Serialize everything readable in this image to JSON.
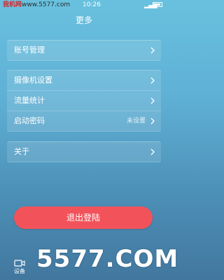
{
  "status_bar": {
    "site_name": "我机网",
    "site_url": "www.5577.com",
    "time": "10:26"
  },
  "header": {
    "title": "更多"
  },
  "sections": [
    {
      "items": [
        {
          "label": "账号管理"
        }
      ]
    },
    {
      "items": [
        {
          "label": "摄像机设置"
        },
        {
          "label": "流量统计"
        },
        {
          "label": "启动密码",
          "value": "未设置"
        }
      ]
    },
    {
      "items": [
        {
          "label": "关于"
        }
      ]
    }
  ],
  "logout_label": "退出登陆",
  "tabbar": {
    "tabs": [
      {
        "label": "设备"
      }
    ]
  },
  "watermark": {
    "text": "5577.COM"
  },
  "colors": {
    "accent": "#f2535a",
    "background_top": "#68c1de",
    "background_bottom": "#42779f"
  },
  "icons": [
    "chevron-right-icon",
    "device-camera-icon",
    "signal-icon",
    "battery-icon"
  ]
}
